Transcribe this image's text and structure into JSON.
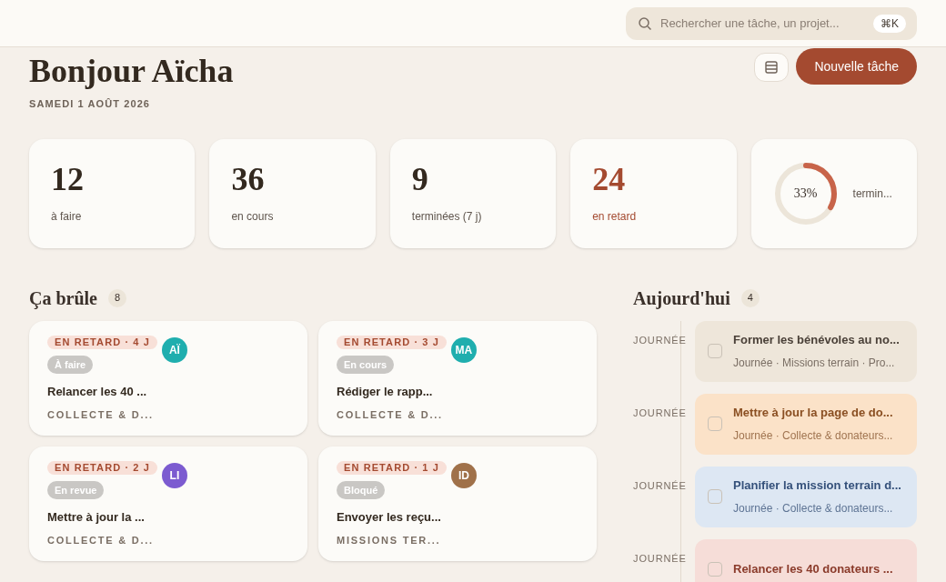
{
  "search": {
    "placeholder": "Rechercher une tâche, un projet...",
    "shortcut": "⌘K"
  },
  "greeting": {
    "title": "Bonjour Aïcha",
    "date": "SAMEDI 1 AOÛT 2026"
  },
  "actions": {
    "new_task": "Nouvelle tâche"
  },
  "stats": [
    {
      "kind": "count",
      "value": "12",
      "label": "à faire",
      "alert": false
    },
    {
      "kind": "count",
      "value": "36",
      "label": "en cours",
      "alert": false
    },
    {
      "kind": "count",
      "value": "9",
      "label": "terminées (7 j)",
      "alert": false
    },
    {
      "kind": "count",
      "value": "24",
      "label": "en retard",
      "alert": true
    },
    {
      "kind": "ring",
      "value": "33%",
      "label": "termin...",
      "level": 0.33
    }
  ],
  "urgent": {
    "title": "Ça brûle",
    "count": "8",
    "cards": [
      {
        "overdue": "EN RETARD · 4 J",
        "status": "À faire",
        "avatar": "AÏ",
        "color": "#1faeae",
        "title": "Relancer les 40 ...",
        "project": "COLLECTE & D..."
      },
      {
        "overdue": "EN RETARD · 3 J",
        "status": "En cours",
        "avatar": "MA",
        "color": "#1faeae",
        "title": "Rédiger le rapp...",
        "project": "COLLECTE & D..."
      },
      {
        "overdue": "EN RETARD · 2 J",
        "status": "En revue",
        "avatar": "LI",
        "color": "#7c5bd0",
        "title": "Mettre à jour la ...",
        "project": "COLLECTE & D..."
      },
      {
        "overdue": "EN RETARD · 1 J",
        "status": "Bloqué",
        "avatar": "ID",
        "color": "#a0714a",
        "title": "Envoyer les reçu...",
        "project": "MISSIONS TER..."
      }
    ]
  },
  "today": {
    "title": "Aujourd'hui",
    "count": "4",
    "items": [
      {
        "time": "JOURNÉE",
        "color": "#eee6da",
        "checked": false,
        "title": "Former les bénévoles au no...",
        "meta": "Journée · Missions terrain · Pro..."
      },
      {
        "time": "JOURNÉE",
        "color": "#fbe2c8",
        "checked": false,
        "title": "Mettre à jour la page de do...",
        "meta": "Journée · Collecte & donateurs..."
      },
      {
        "time": "JOURNÉE",
        "color": "#dde7f3",
        "checked": false,
        "title": "Planifier la mission terrain d...",
        "meta": "Journée · Collecte & donateurs..."
      },
      {
        "time": "JOURNÉE",
        "color": "#f6ddd8",
        "checked": false,
        "title": "Relancer les 40 donateurs ..."
      }
    ]
  }
}
